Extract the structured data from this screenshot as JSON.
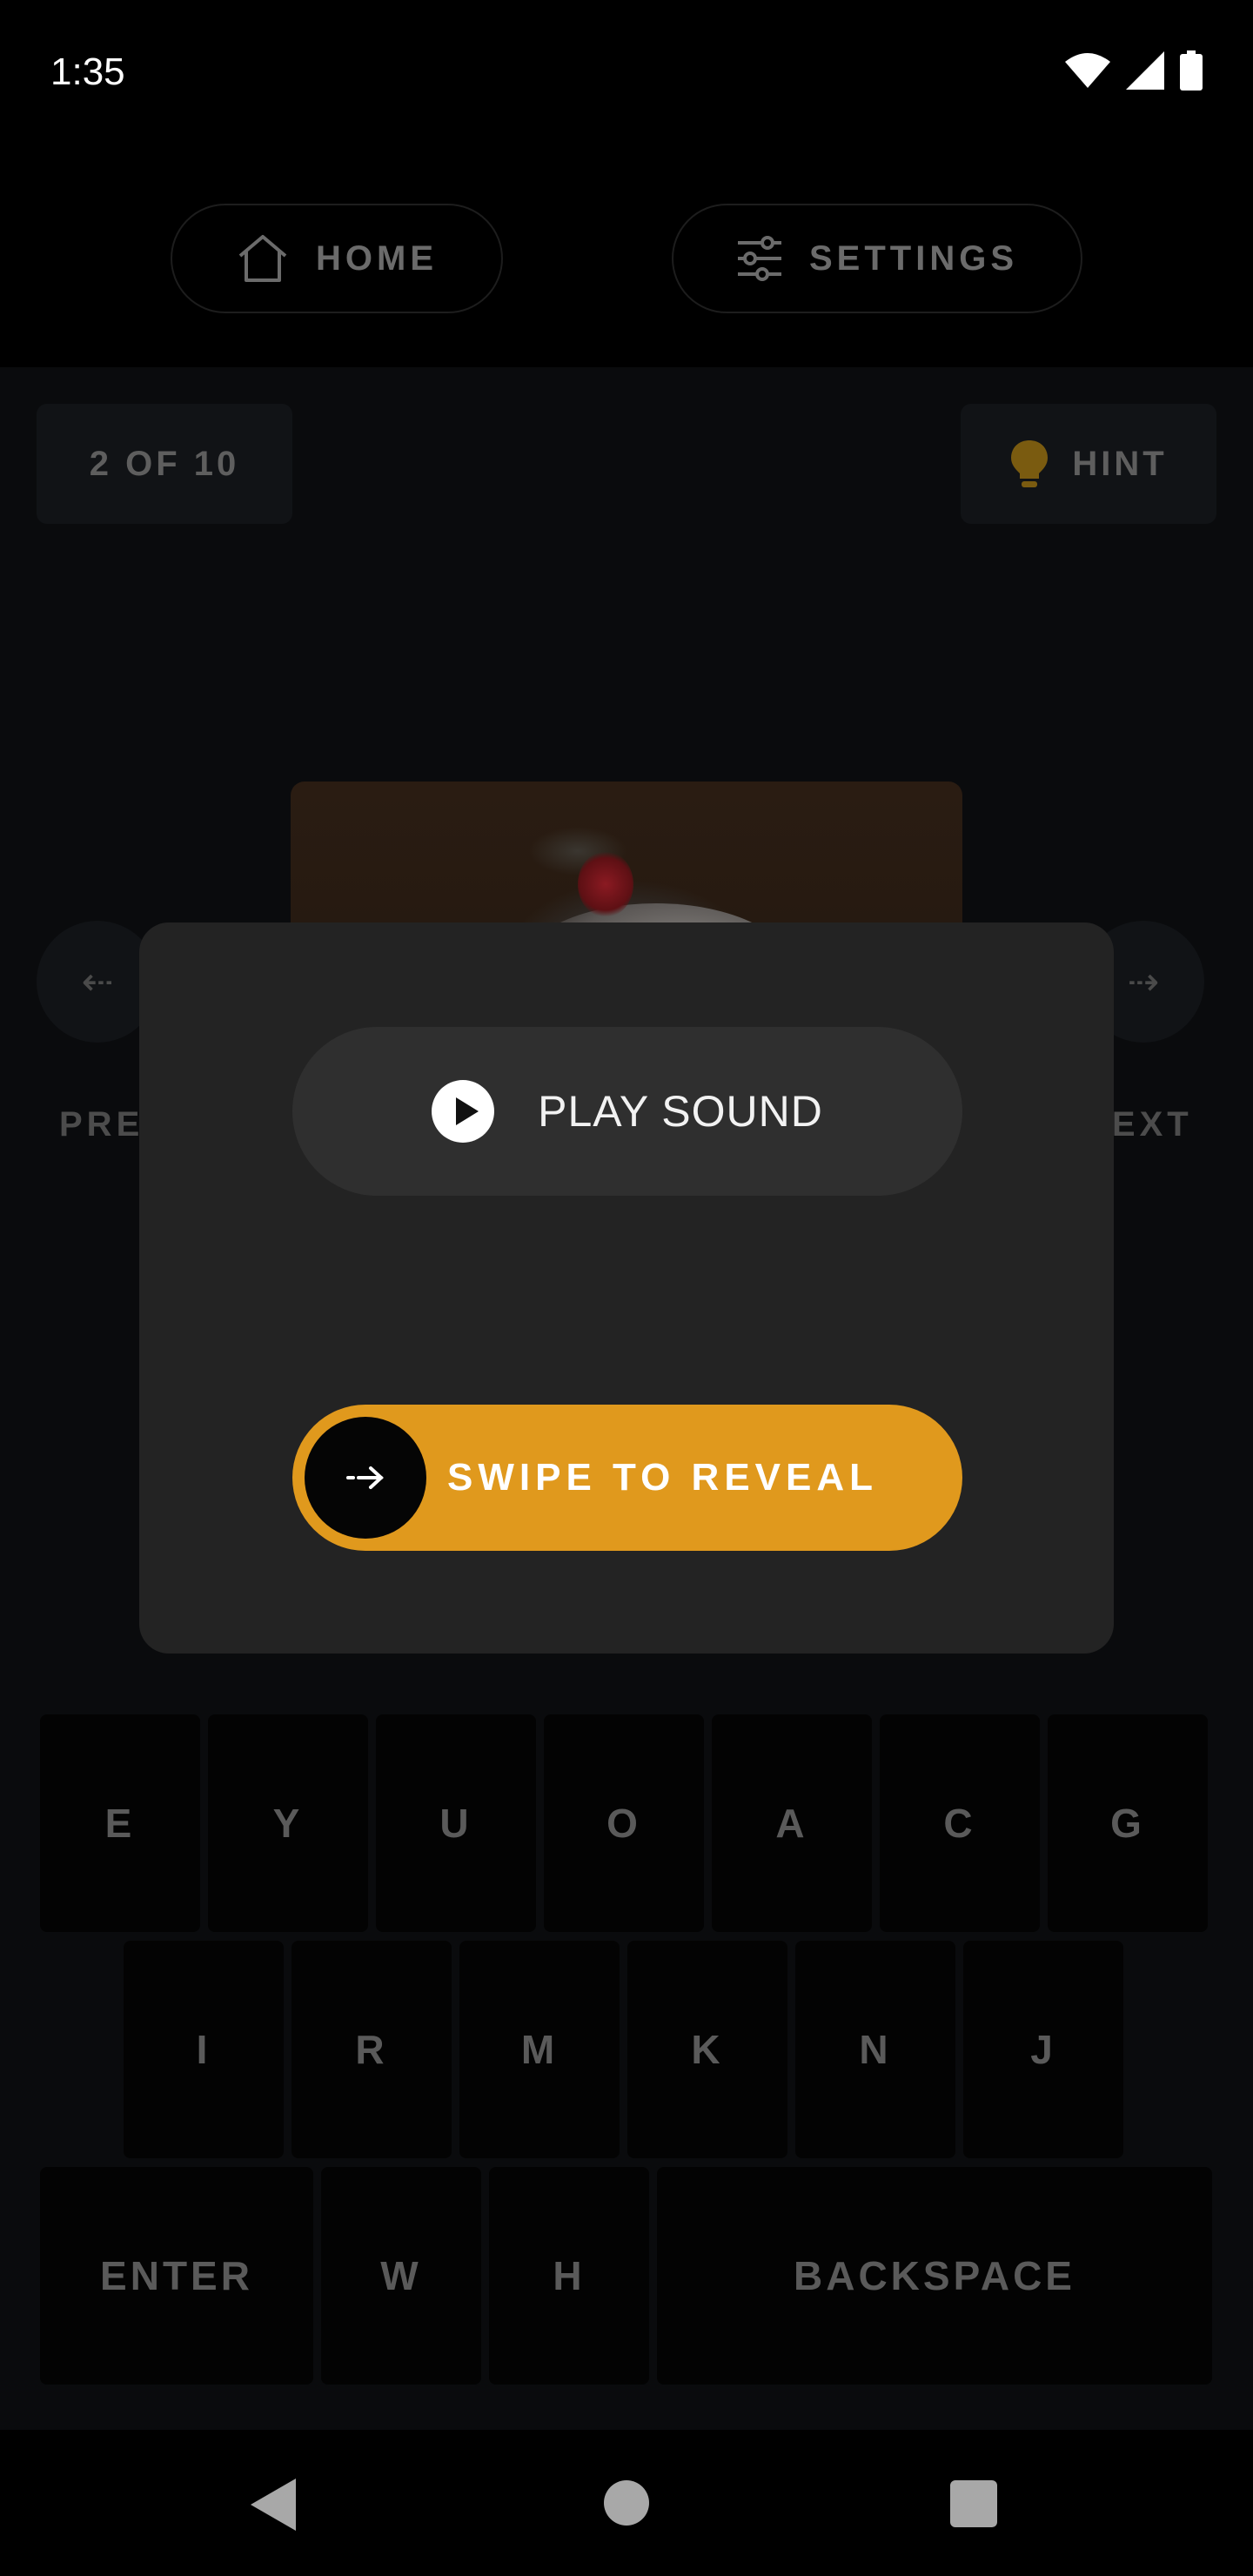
{
  "status": {
    "time": "1:35"
  },
  "topnav": {
    "home_label": "HOME",
    "settings_label": "SETTINGS"
  },
  "game": {
    "counter": "2 OF 10",
    "hint_label": "HINT",
    "prev_label": "PREV",
    "next_label": "NEXT"
  },
  "modal": {
    "play_label": "PLAY SOUND",
    "swipe_label": "SWIPE TO REVEAL"
  },
  "keyboard": {
    "row1": [
      "E",
      "Y",
      "U",
      "O",
      "A",
      "C",
      "G"
    ],
    "row2": [
      "I",
      "R",
      "M",
      "K",
      "N",
      "J"
    ],
    "row3": [
      "ENTER",
      "W",
      "H",
      "BACKSPACE"
    ]
  },
  "colors": {
    "accent": "#e0991d",
    "modal_bg": "#232323",
    "background": "#0a0b0d"
  }
}
